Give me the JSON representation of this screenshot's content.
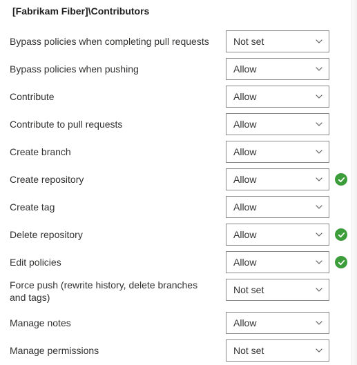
{
  "title": "[Fabrikam Fiber]\\Contributors",
  "colors": {
    "success": "#3b9e3b",
    "border": "#8a8886",
    "text": "#323130"
  },
  "permissions": [
    {
      "label": "Bypass policies when completing pull requests",
      "value": "Not set",
      "inherited": false
    },
    {
      "label": "Bypass policies when pushing",
      "value": "Allow",
      "inherited": false
    },
    {
      "label": "Contribute",
      "value": "Allow",
      "inherited": false
    },
    {
      "label": "Contribute to pull requests",
      "value": "Allow",
      "inherited": false
    },
    {
      "label": "Create branch",
      "value": "Allow",
      "inherited": false
    },
    {
      "label": "Create repository",
      "value": "Allow",
      "inherited": true
    },
    {
      "label": "Create tag",
      "value": "Allow",
      "inherited": false
    },
    {
      "label": "Delete repository",
      "value": "Allow",
      "inherited": true
    },
    {
      "label": "Edit policies",
      "value": "Allow",
      "inherited": true
    },
    {
      "label": "Force push (rewrite history, delete branches and tags)",
      "value": "Not set",
      "inherited": false
    },
    {
      "label": "Manage notes",
      "value": "Allow",
      "inherited": false
    },
    {
      "label": "Manage permissions",
      "value": "Not set",
      "inherited": false
    }
  ]
}
